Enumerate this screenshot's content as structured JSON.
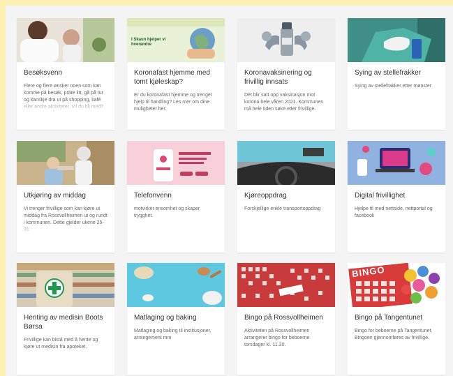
{
  "cards": [
    {
      "title": "Besøksvenn",
      "desc": "Flere og flere ønsker noen som kan komme på besøk, prate litt, gå på tur og kanskje dra ut på shopping, kafé eller andre aktiviteter. Vil du bli med?",
      "image_icon": "visit-photo-icon"
    },
    {
      "title": "Koronafast hjemme med tomt kjøleskap?",
      "desc": "Er du koronafast hjemme og trenger hjelp til handling? Les mer om dine muligheter her.",
      "image_icon": "corona-help-icon",
      "image_caption": "I Skaun hjelper vi hverandre"
    },
    {
      "title": "Koronavaksinering og frivillig innsats",
      "desc": "Det blir satt opp vaksinasjon mot korona hele våren 2021. Kommunen må hele tiden søke etter frivillige.",
      "image_icon": "vaccine-icon"
    },
    {
      "title": "Sying av stellefrakker",
      "desc": "Sying av stellefrakker etter mønster",
      "image_icon": "sewing-gloves-icon"
    },
    {
      "title": "Utkjøring av middag",
      "desc": "Vi trenger frivillige som kan kjøre ut middag fra Rossvollheimen ut og rundt i kommunen. Dette gjelder ukene 25-31.",
      "image_icon": "dinner-delivery-icon"
    },
    {
      "title": "Telefonvenn",
      "desc": "motvirker ensomhet og skaper trygghet.",
      "image_icon": "phone-friend-icon"
    },
    {
      "title": "Kjøreoppdrag",
      "desc": "Forskjellige enkle transportoppdrag",
      "image_icon": "car-dashboard-icon"
    },
    {
      "title": "Digital frivillighet",
      "desc": "Hjelpe til med nettside, nettportal og facebook",
      "image_icon": "digital-icon"
    },
    {
      "title": "Henting av medisin Boots Børsa",
      "desc": "Frivillige kan bistå med å hente og kjøre ut medisin fra apoteket.",
      "image_icon": "pharmacy-bag-icon"
    },
    {
      "title": "Matlaging og baking",
      "desc": "Matlaging og baking til institusjoner, arrangement mm",
      "image_icon": "baking-icon"
    },
    {
      "title": "Bingo på Rossvollheimen",
      "desc": "Aktiviteten på Rossvollheimen arrangerer bingo for beboerne torsdager kl. 11.30.",
      "image_icon": "bingo-cards-icon"
    },
    {
      "title": "Bingo på Tangentunet",
      "desc": "Bingo for beboerne på Tangentunet. Bingoen gjennomføres av frivillige.",
      "image_icon": "bingo-balls-icon",
      "image_caption": "BINGO"
    }
  ],
  "colors": {
    "background": "#fdf0b3",
    "panel": "#f4f4f4",
    "card": "#ffffff",
    "title": "#333333",
    "text": "#666666"
  }
}
